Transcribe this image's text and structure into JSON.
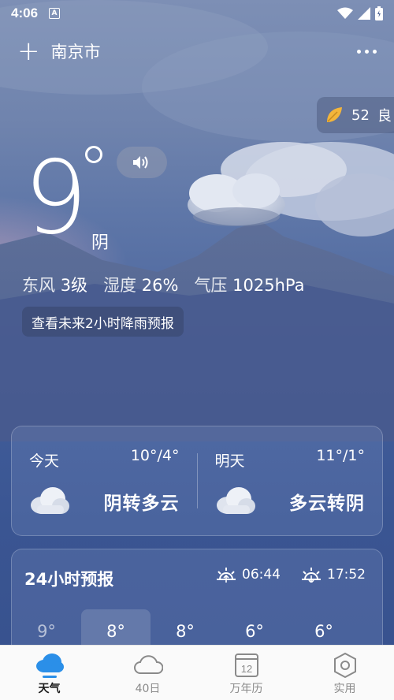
{
  "status_bar": {
    "time": "4:06"
  },
  "header": {
    "add": "+",
    "city": "南京市"
  },
  "aqi": {
    "value": "52",
    "level": "良"
  },
  "current": {
    "temperature": "9",
    "condition": "阴",
    "wind": {
      "label": "东风",
      "value": "3级"
    },
    "humidity": {
      "label": "湿度",
      "value": "26%"
    },
    "pressure": {
      "label": "气压",
      "value": "1025hPa"
    },
    "rain_link": "查看未来2小时降雨预报"
  },
  "days": [
    {
      "name": "今天",
      "range": "10°/4°",
      "condition": "阴转多云",
      "icon": "cloud-icon"
    },
    {
      "name": "明天",
      "range": "11°/1°",
      "condition": "多云转阴",
      "icon": "cloud-icon"
    }
  ],
  "hourly": {
    "title": "24小时预报",
    "sunrise": "06:44",
    "sunset": "17:52",
    "temps": [
      "9°",
      "8°",
      "8°",
      "6°",
      "6°"
    ]
  },
  "tabs": [
    {
      "label": "天气",
      "icon": "weather-cloud-icon",
      "active": true
    },
    {
      "label": "40日",
      "icon": "cloud-outline-icon",
      "active": false
    },
    {
      "label": "万年历",
      "icon": "calendar-icon",
      "calendar_number": "12",
      "active": false
    },
    {
      "label": "实用",
      "icon": "tools-icon",
      "active": false
    }
  ],
  "colors": {
    "tab_active_blue": "#2b8fe8",
    "aqi_leaf": "#f3b53a"
  }
}
